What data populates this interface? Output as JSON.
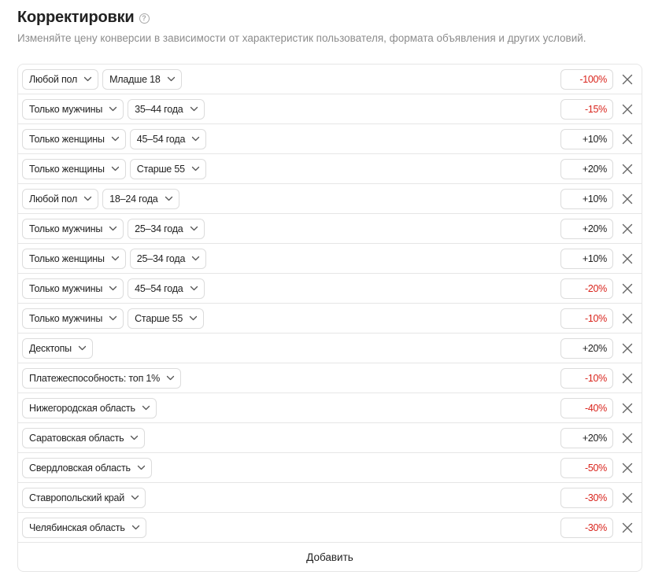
{
  "header": {
    "title": "Корректировки",
    "help_icon": "question-circle-icon",
    "subtitle": "Изменяйте цену конверсии в зависимости от характеристик пользователя, формата объявления и других условий."
  },
  "adjustments": [
    {
      "chips": [
        "Любой пол",
        "Младше 18"
      ],
      "value": "-100%",
      "sign": "neg"
    },
    {
      "chips": [
        "Только мужчины",
        "35–44 года"
      ],
      "value": "-15%",
      "sign": "neg"
    },
    {
      "chips": [
        "Только женщины",
        "45–54 года"
      ],
      "value": "+10%",
      "sign": "pos"
    },
    {
      "chips": [
        "Только женщины",
        "Старше 55"
      ],
      "value": "+20%",
      "sign": "pos"
    },
    {
      "chips": [
        "Любой пол",
        "18–24 года"
      ],
      "value": "+10%",
      "sign": "pos"
    },
    {
      "chips": [
        "Только мужчины",
        "25–34 года"
      ],
      "value": "+20%",
      "sign": "pos"
    },
    {
      "chips": [
        "Только женщины",
        "25–34 года"
      ],
      "value": "+10%",
      "sign": "pos"
    },
    {
      "chips": [
        "Только мужчины",
        "45–54 года"
      ],
      "value": "-20%",
      "sign": "neg"
    },
    {
      "chips": [
        "Только мужчины",
        "Старше 55"
      ],
      "value": "-10%",
      "sign": "neg"
    },
    {
      "chips": [
        "Десктопы"
      ],
      "value": "+20%",
      "sign": "pos"
    },
    {
      "chips": [
        "Платежеспособность: топ 1%"
      ],
      "value": "-10%",
      "sign": "neg"
    },
    {
      "chips": [
        "Нижегородская область"
      ],
      "value": "-40%",
      "sign": "neg"
    },
    {
      "chips": [
        "Саратовская область"
      ],
      "value": "+20%",
      "sign": "pos"
    },
    {
      "chips": [
        "Свердловская область"
      ],
      "value": "-50%",
      "sign": "neg"
    },
    {
      "chips": [
        "Ставропольский край"
      ],
      "value": "-30%",
      "sign": "neg"
    },
    {
      "chips": [
        "Челябинская область"
      ],
      "value": "-30%",
      "sign": "neg"
    }
  ],
  "add_button": "Добавить",
  "icons": {
    "dropdown": "chevron-down-icon",
    "remove": "close-icon"
  },
  "colors": {
    "negative": "#d9241c",
    "border": "#e6e6e6",
    "muted": "#8c8c8c"
  }
}
